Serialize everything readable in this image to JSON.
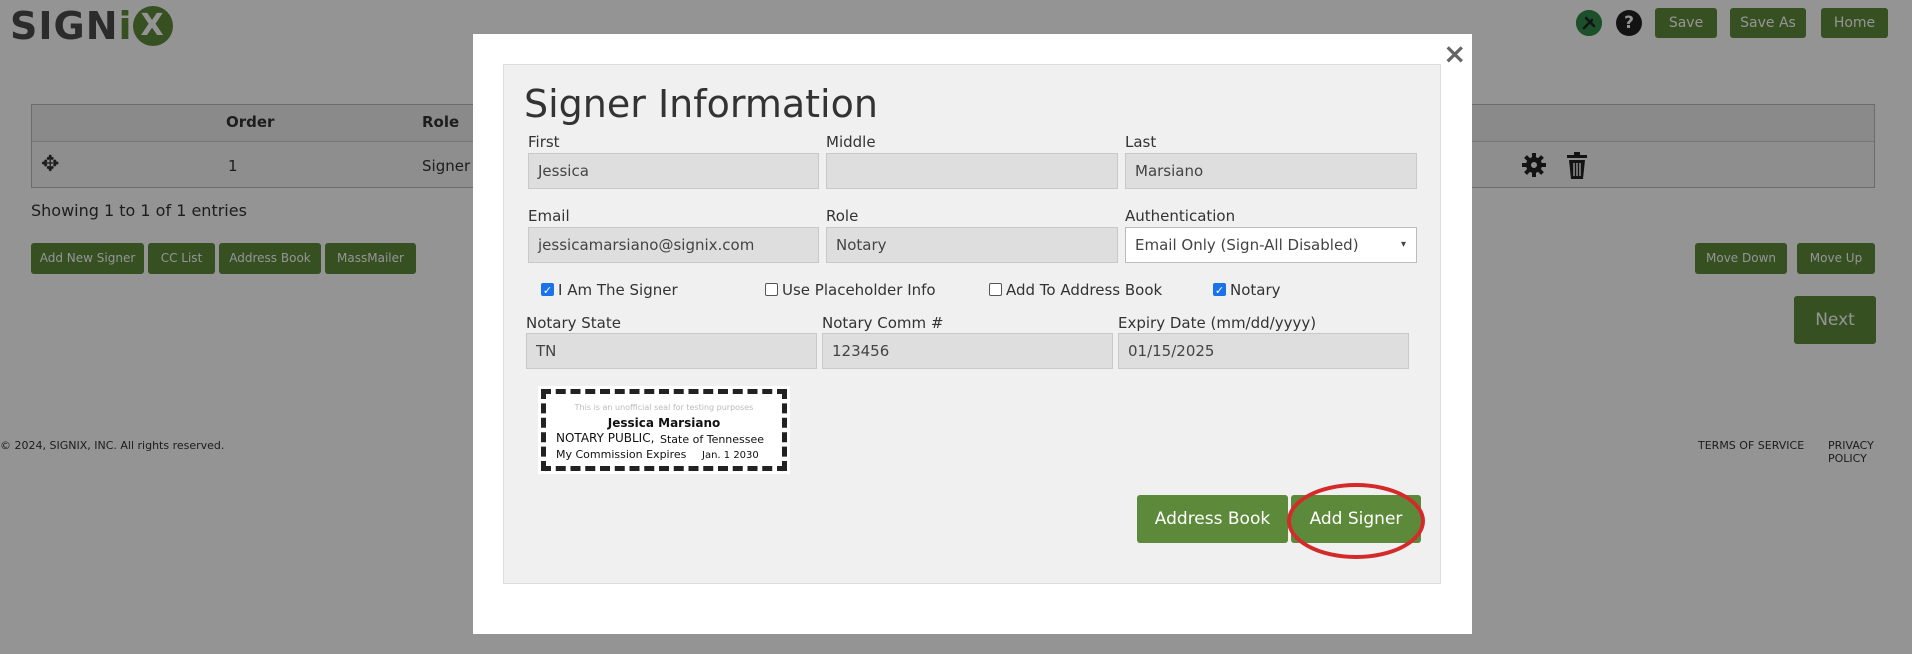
{
  "header": {
    "logo": {
      "pre": "SIGN",
      "i": "i",
      "x": "X"
    },
    "icons": {
      "tools": "tools-icon",
      "help": "?"
    },
    "buttons": {
      "save": "Save",
      "save_as": "Save As",
      "home": "Home"
    }
  },
  "table": {
    "columns": {
      "order": "Order",
      "role": "Role"
    },
    "row": {
      "move_icon": "✥",
      "order": "1",
      "role": "Signer"
    },
    "info": "Showing 1 to 1 of 1 entries"
  },
  "actions": {
    "add_new_signer": "Add New Signer",
    "cc_list": "CC List",
    "address_book": "Address Book",
    "massmailer": "MassMailer",
    "move_down": "Move Down",
    "move_up": "Move Up",
    "next": "Next"
  },
  "footer": {
    "copyright": "© 2024, SIGNIX, INC. All rights reserved.",
    "terms": "TERMS OF SERVICE",
    "privacy": "PRIVACY POLICY"
  },
  "modal": {
    "close": "×",
    "title": "Signer Information",
    "labels": {
      "first": "First",
      "middle": "Middle",
      "last": "Last",
      "email": "Email",
      "role": "Role",
      "authentication": "Authentication",
      "notary_state": "Notary State",
      "notary_comm": "Notary Comm #",
      "expiry": "Expiry Date (mm/dd/yyyy)"
    },
    "values": {
      "first": "Jessica",
      "middle": "",
      "last": "Marsiano",
      "email": "jessicamarsiano@signix.com",
      "role": "Notary",
      "authentication": "Email Only (Sign-All Disabled)",
      "notary_state": "TN",
      "notary_comm": "123456",
      "expiry": "01/15/2025"
    },
    "checkboxes": {
      "i_am_signer": {
        "label": "I Am The Signer",
        "checked": true
      },
      "use_placeholder": {
        "label": "Use Placeholder Info",
        "checked": false
      },
      "add_to_address_book": {
        "label": "Add To Address Book",
        "checked": false
      },
      "notary": {
        "label": "Notary",
        "checked": true
      }
    },
    "seal": {
      "disclaimer": "This is an unofficial seal for testing purposes",
      "name": "Jessica Marsiano",
      "line1a": "NOTARY PUBLIC,",
      "line1b": "State of Tennessee",
      "line2a": "My Commission Expires",
      "line2b": "Jan. 1 2030"
    },
    "buttons": {
      "address_book": "Address Book",
      "add_signer": "Add Signer"
    }
  },
  "colors": {
    "brand_green": "#5d8a3a",
    "highlight_red": "#d42a2a"
  }
}
